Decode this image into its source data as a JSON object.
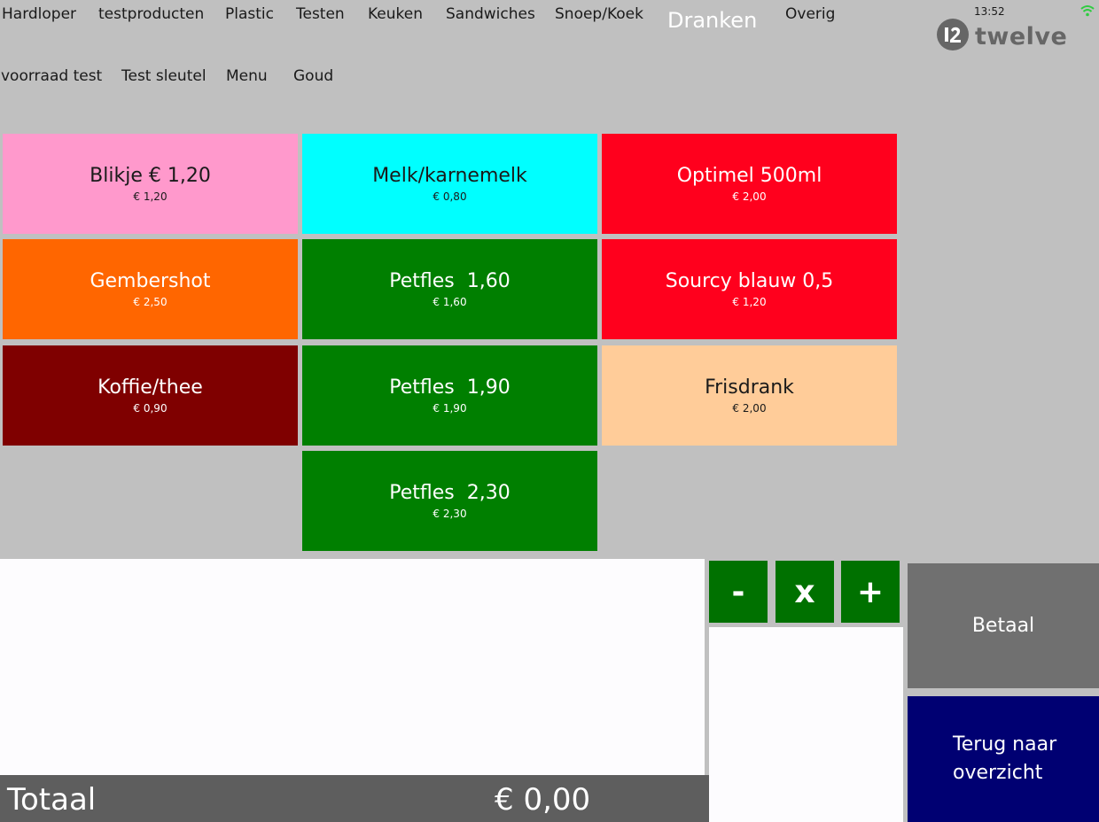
{
  "categories_row1": [
    "Hardloper",
    "testproducten",
    "Plastic",
    "Testen",
    "Keuken",
    "Sandwiches",
    "Snoep/Koek",
    "Dranken",
    "Overig"
  ],
  "categories_row2": [
    "voorraad test",
    "Test sleutel",
    "Menu",
    "Goud"
  ],
  "active_category": "Dranken",
  "status": {
    "time": "13:52",
    "brand": "twelve"
  },
  "products": [
    {
      "name": "Blikje € 1,20",
      "price": "€ 1,20",
      "color": "#ff99cc"
    },
    {
      "name": "Melk/karnemelk",
      "price": "€ 0,80",
      "color": "#00ffff"
    },
    {
      "name": "Optimel 500ml",
      "price": "€ 2,00",
      "color": "#ff001d"
    },
    {
      "name": "Gembershot",
      "price": "€ 2,50",
      "color": "#ff6600"
    },
    {
      "name": "Petfles  1,60",
      "price": "€ 1,60",
      "color": "#007f00"
    },
    {
      "name": "Sourcy blauw 0,5",
      "price": "€ 1,20",
      "color": "#ff001d"
    },
    {
      "name": "Koffie/thee",
      "price": "€ 0,90",
      "color": "#7f0000"
    },
    {
      "name": "Petfles  1,90",
      "price": "€ 1,90",
      "color": "#007f00"
    },
    {
      "name": "Frisdrank",
      "price": "€ 2,00",
      "color": "#ffcc99"
    },
    {
      "name": "Petfles  2,30",
      "price": "€ 2,30",
      "color": "#007f00"
    }
  ],
  "order": {
    "total_label": "Totaal",
    "total_value": "€ 0,00"
  },
  "quantity_buttons": {
    "minus": "-",
    "remove": "x",
    "plus": "+"
  },
  "actions": {
    "pay": "Betaal",
    "back": "Terug naar\noverzicht"
  },
  "colors": {
    "background": "#c0c0c0",
    "qty_button": "#007100",
    "pay_button": "#707070",
    "back_button": "#000072",
    "total_bar": "#5e5e5e"
  }
}
